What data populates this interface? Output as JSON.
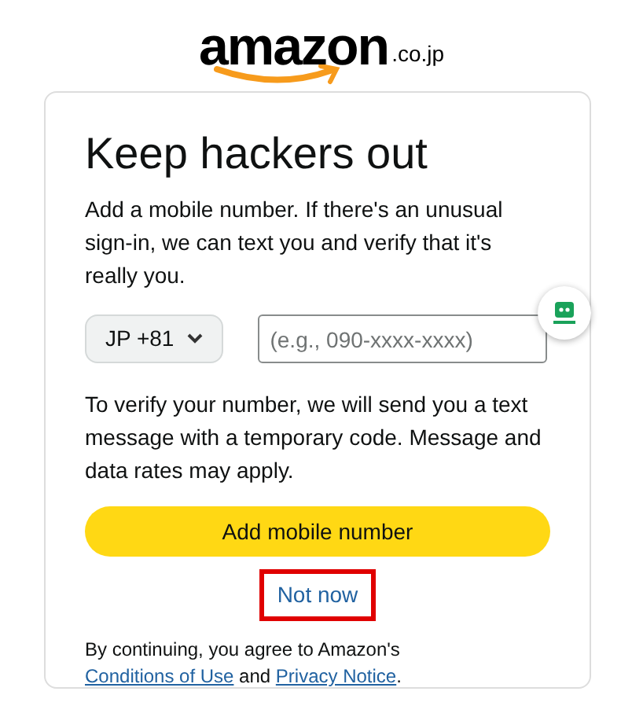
{
  "logo": {
    "wordmark": "amazon",
    "domain": ".co.jp"
  },
  "title": "Keep hackers out",
  "intro": "Add a mobile number. If there's an unusual sign-in, we can text you and verify that it's really you.",
  "country_select": {
    "value": "JP +81"
  },
  "phone_field": {
    "placeholder": "(e.g., 090-xxxx-xxxx)"
  },
  "info": "To verify your number, we will send you a text message with a temporary code. Message and data rates may apply.",
  "primary_button": {
    "label": "Add mobile number"
  },
  "secondary_link": {
    "label": "Not now",
    "highlighted": true
  },
  "legal": {
    "before": "By continuing, you agree to Amazon's",
    "link_1": "Conditions of Use",
    "middle": "and",
    "link_2": "Privacy Notice",
    "after": "."
  }
}
